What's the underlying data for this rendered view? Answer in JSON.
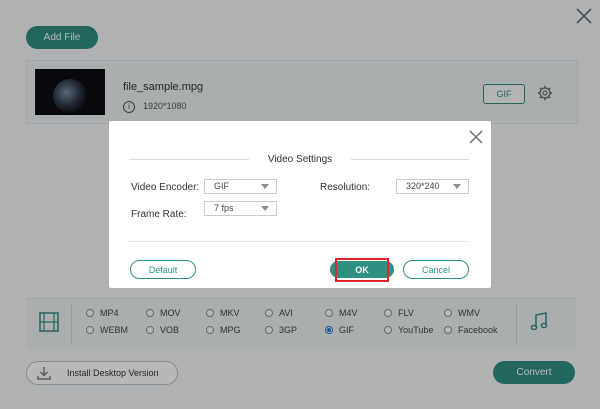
{
  "app": {
    "add_file_label": "Add File",
    "file": {
      "name": "file_sample.mpg",
      "resolution": "1920*1080",
      "format_button": "GIF"
    },
    "install_label": "Install Desktop Version",
    "convert_label": "Convert",
    "formats": [
      {
        "label": "MP4",
        "selected": false
      },
      {
        "label": "MOV",
        "selected": false
      },
      {
        "label": "MKV",
        "selected": false
      },
      {
        "label": "AVI",
        "selected": false
      },
      {
        "label": "M4V",
        "selected": false
      },
      {
        "label": "FLV",
        "selected": false
      },
      {
        "label": "WMV",
        "selected": false
      },
      {
        "label": "WEBM",
        "selected": false
      },
      {
        "label": "VOB",
        "selected": false
      },
      {
        "label": "MPG",
        "selected": false
      },
      {
        "label": "3GP",
        "selected": false
      },
      {
        "label": "GIF",
        "selected": true
      },
      {
        "label": "YouTube",
        "selected": false
      },
      {
        "label": "Facebook",
        "selected": false
      }
    ]
  },
  "dialog": {
    "title": "Video Settings",
    "video_encoder_label": "Video Encoder:",
    "video_encoder_value": "GIF",
    "frame_rate_label": "Frame Rate:",
    "frame_rate_value": "7 fps",
    "resolution_label": "Resolution:",
    "resolution_value": "320*240",
    "default_label": "Default",
    "ok_label": "OK",
    "cancel_label": "Cancel"
  },
  "colors": {
    "accent": "#2f8f83",
    "highlight": "#e0242a",
    "radio_selected": "#2b6fd6"
  }
}
